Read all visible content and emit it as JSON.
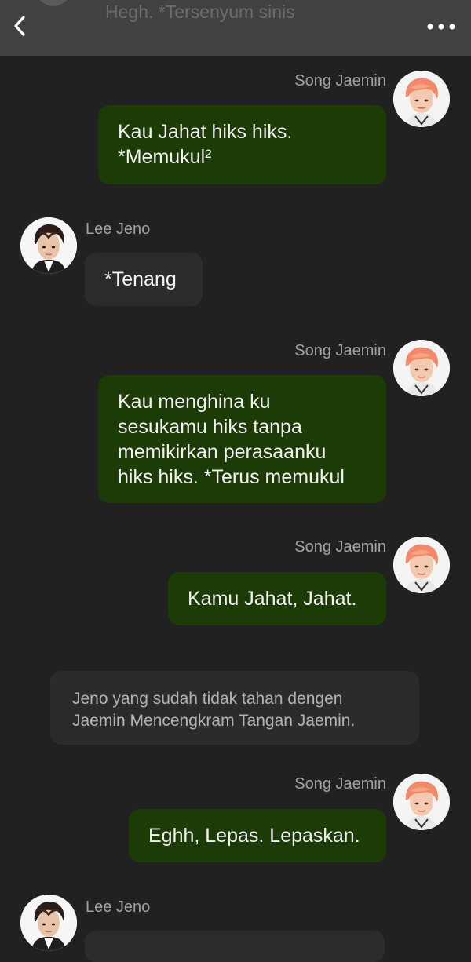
{
  "header": {
    "previous_message_preview": "Hegh. *Tersenyum sinis",
    "back_icon": "chevron-left-icon",
    "more_icon": "more-horizontal-icon"
  },
  "messages": [
    {
      "sender": "Song Jaemin",
      "side": "right",
      "text": "Kau Jahat hiks hiks.\n*Memukul²"
    },
    {
      "sender": "Lee Jeno",
      "side": "left",
      "text": "*Tenang"
    },
    {
      "sender": "Song Jaemin",
      "side": "right",
      "text": "Kau menghina ku\nsesukamu hiks tanpa\nmemikirkan perasaanku\nhiks hiks. *Terus memukul"
    },
    {
      "sender": "Song Jaemin",
      "side": "right",
      "text": "Kamu Jahat, Jahat."
    },
    {
      "narration": "Jeno yang sudah tidak tahan dengen\nJaemin Mencengkram Tangan Jaemin."
    },
    {
      "sender": "Song Jaemin",
      "side": "right",
      "text": "Eghh, Lepas. Lepaskan."
    },
    {
      "sender": "Lee Jeno",
      "side": "left",
      "text": ""
    }
  ],
  "colors": {
    "background": "#212121",
    "header": "#424242",
    "sent_bubble": "#1c3b06",
    "received_bubble": "#2c2c2c",
    "narration_bubble": "#2b2b2b"
  }
}
